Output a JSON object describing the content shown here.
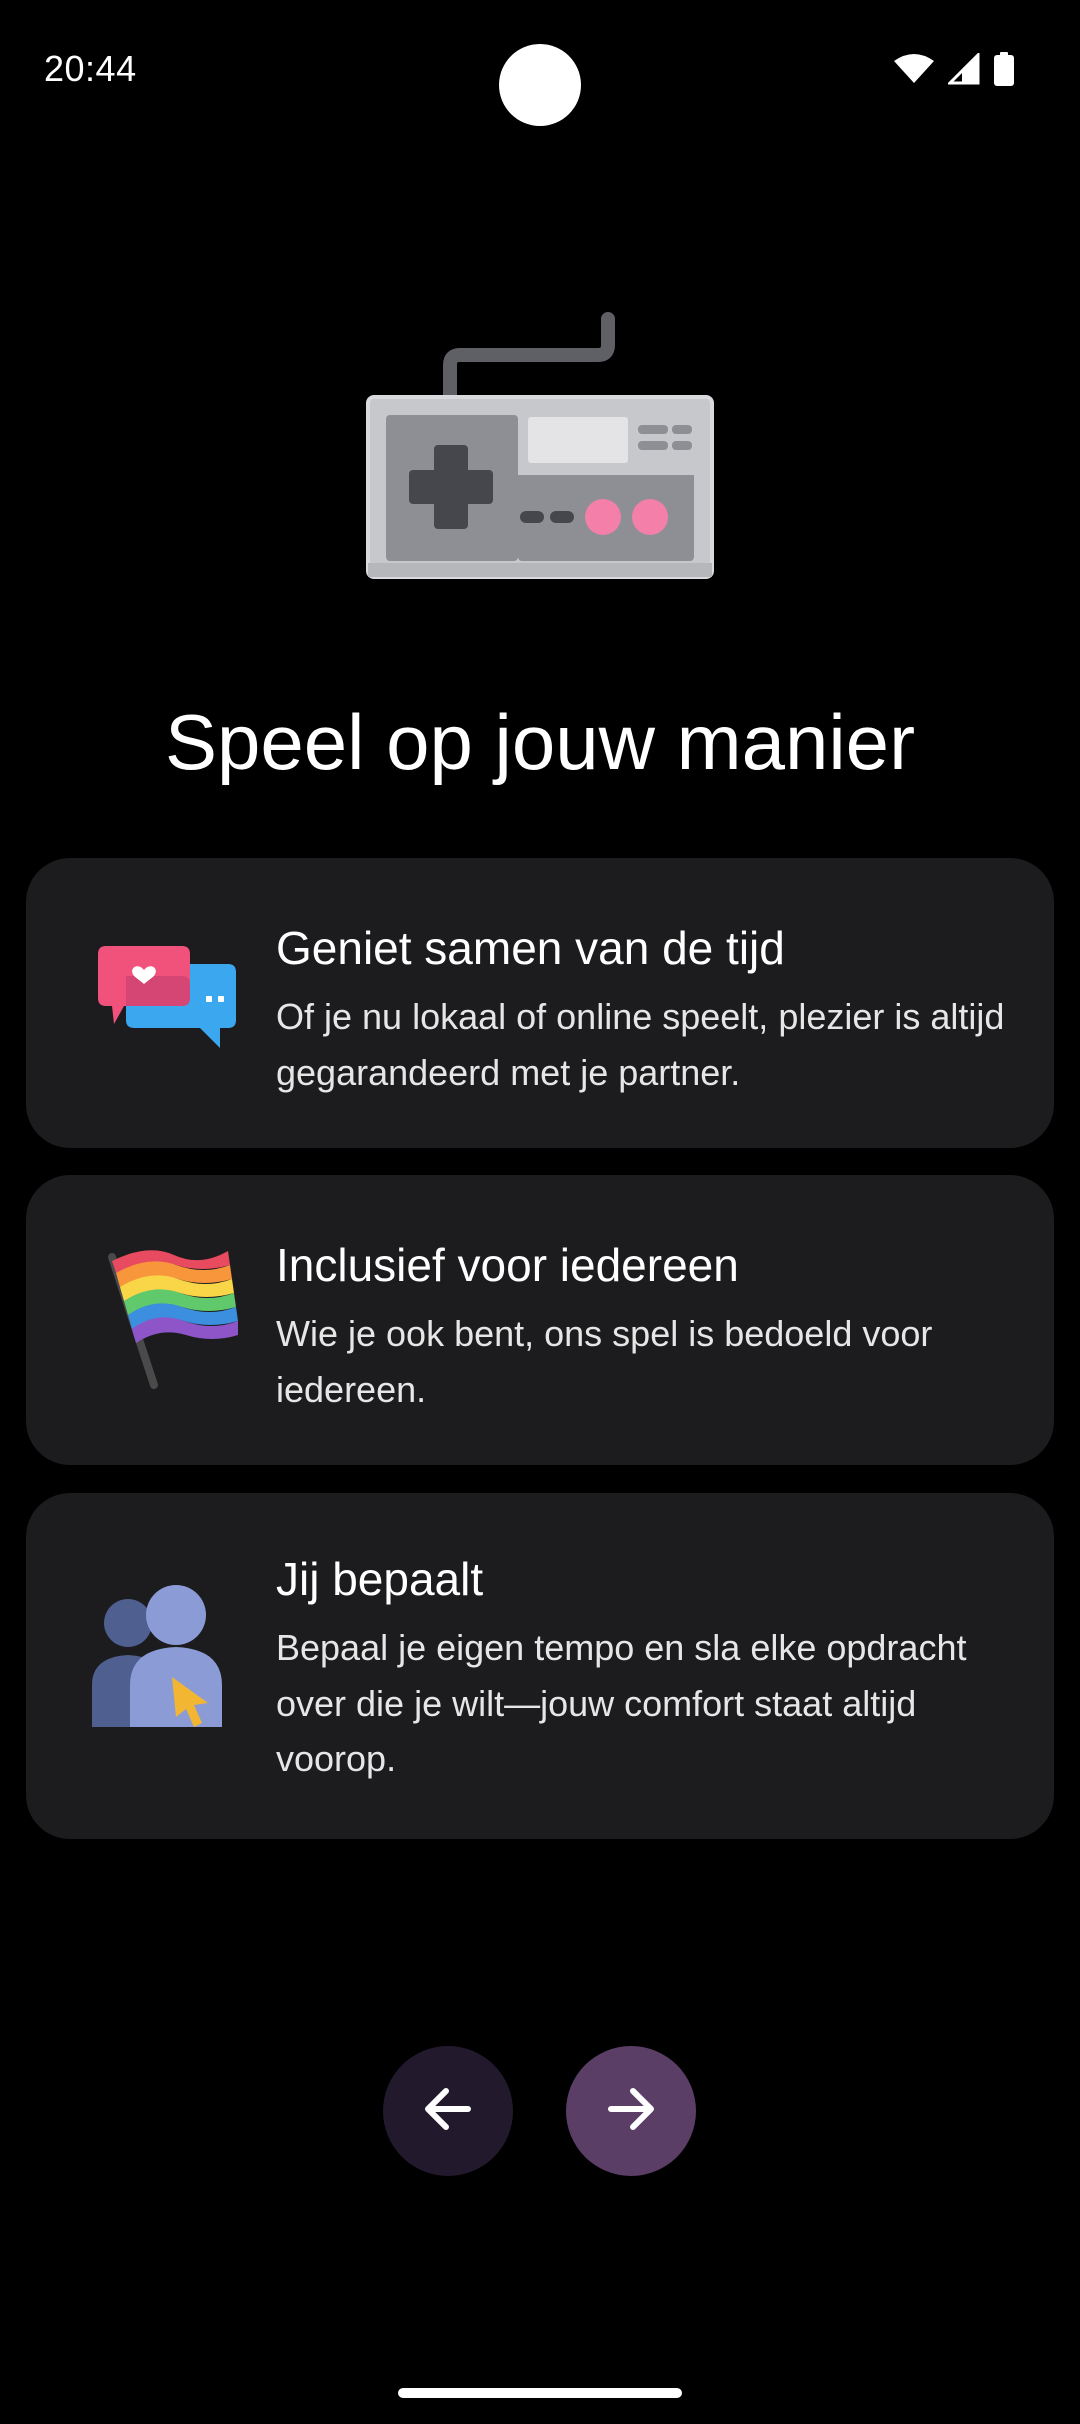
{
  "status_bar": {
    "time": "20:44",
    "icons": [
      "wifi-icon",
      "signal-icon",
      "battery-icon"
    ]
  },
  "hero": {
    "icon": "game-controller-icon"
  },
  "title": "Speel op jouw manier",
  "features": [
    {
      "icon": "chat-bubbles-heart-icon",
      "title": "Geniet samen van de tijd",
      "description": "Of je nu lokaal of online speelt, plezier is altijd gegarandeerd met je partner."
    },
    {
      "icon": "rainbow-flag-icon",
      "title": "Inclusief voor iedereen",
      "description": "Wie je ook bent, ons spel is bedoeld voor iedereen."
    },
    {
      "icon": "users-cursor-icon",
      "title": "Jij bepaalt",
      "description": "Bepaal je eigen tempo en sla elke opdracht over die je wilt—jouw comfort staat altijd voorop."
    }
  ],
  "navigation": {
    "prev_icon": "arrow-left-icon",
    "next_icon": "arrow-right-icon"
  },
  "colors": {
    "background": "#000000",
    "card": "#1c1c1e",
    "prev_button": "#221a2c",
    "next_button": "#5b3e66"
  }
}
